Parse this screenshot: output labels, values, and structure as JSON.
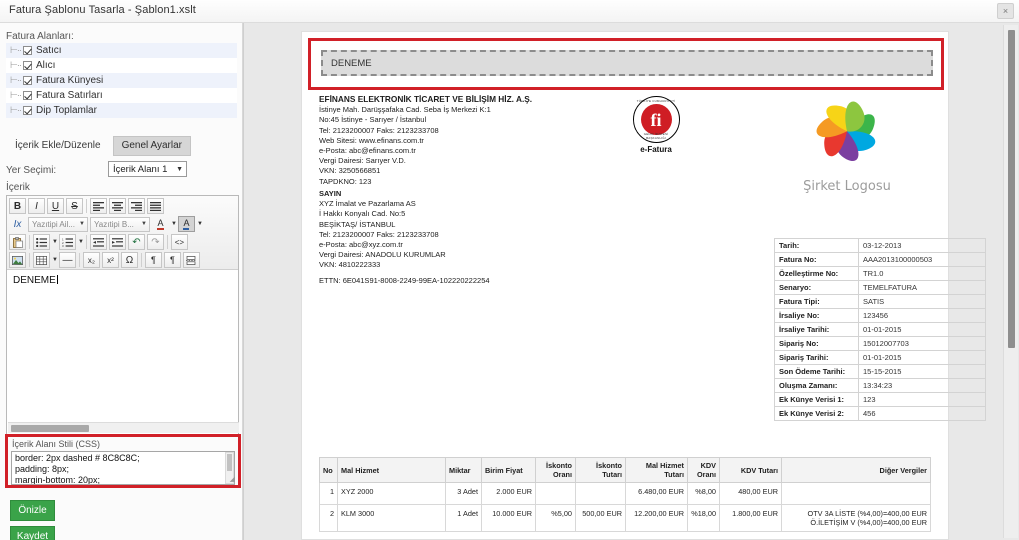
{
  "window": {
    "title": "Fatura Şablonu Tasarla - Şablon1.xslt",
    "close_label": "×"
  },
  "sidebar": {
    "fields_label": "Fatura Alanları:",
    "tree_items": [
      {
        "label": "Satıcı",
        "checked": true
      },
      {
        "label": "Alıcı",
        "checked": true
      },
      {
        "label": "Fatura Künyesi",
        "checked": true
      },
      {
        "label": "Fatura Satırları",
        "checked": true
      },
      {
        "label": "Dip Toplamlar",
        "checked": true
      }
    ],
    "tabs": [
      {
        "label": "İçerik Ekle/Düzenle",
        "active": false
      },
      {
        "label": "Genel Ayarlar",
        "active": true
      }
    ],
    "placement_label": "Yer Seçimi:",
    "placement_value": "İçerik Alanı 1",
    "content_label": "İçerik",
    "editor_text": "DENEME",
    "css_panel_title": "İçerik Alanı Stili (CSS)",
    "css_value": "border: 2px dashed # 8C8C8C;\npadding: 8px;\nmargin-bottom: 20px;",
    "preview_button": "Önizle",
    "save_button": "Kaydet",
    "toolbar": {
      "bold": "B",
      "italic": "I",
      "underline": "U",
      "strike": "S",
      "align_left": "≡",
      "align_center": "≡",
      "align_right": "≡",
      "justify": "≡",
      "clear_format": "Ix",
      "font_family": "Yazıtipi Ail...",
      "font_size": "Yazıtipi B...",
      "text_color": "A",
      "bg_color": "A",
      "paste": "📋",
      "bullet_list": "≔",
      "numbered_list": "≕",
      "outdent": "⇤",
      "indent": "⇥",
      "undo": "↶",
      "redo": "↷",
      "source": "<>",
      "image": "🖼",
      "table": "⊞",
      "hr": "—",
      "subscript": "x₂",
      "superscript": "x²",
      "symbol": "Ω",
      "paragraph": "¶",
      "paragraph_rtl": "¶",
      "page_break": "⎙"
    }
  },
  "document": {
    "header_text": "DENEME",
    "seller": {
      "name": "EFİNANS ELEKTRONİK TİCARET VE BİLİŞİM HİZ. A.Ş.",
      "lines": [
        "İstinye Mah. Darüşşafaka Cad. Seba İş Merkezi K:1",
        "No:45 İstinye - Sarıyer / İstanbul",
        "Tel: 2123200007 Faks: 2123233708",
        "Web Sitesi: www.efinans.com.tr",
        "e-Posta: abc@efinans.com.tr",
        "Vergi Dairesi: Sarıyer V.D.",
        "VKN: 3250566851",
        "TAPDKNO: 123"
      ]
    },
    "buyer": {
      "title": "SAYIN",
      "lines": [
        "XYZ İmalat ve Pazarlama AS",
        "İ Hakkı Konyalı Cad.  No:5",
        "BEŞİKTAŞ/ İSTANBUL",
        "Tel: 2123200007 Faks: 2123233708",
        "e-Posta: abc@xyz.com.tr",
        "Vergi Dairesi: ANADOLU KURUMLAR",
        "VKN: 4810222333"
      ]
    },
    "ettn": "ETTN: 6E041S91-8008-2249-99EA-102220222254",
    "seal": {
      "ring_top": "TÜRKİYE CUMHURİYETİ",
      "ring_bottom": "GELİR İDARESİ BAŞKANLIĞI",
      "mark": "fi",
      "label": "e-Fatura"
    },
    "company_logo_text": "Şirket Logosu",
    "info_rows": [
      {
        "key": "Tarih:",
        "value": "03-12-2013"
      },
      {
        "key": "Fatura No:",
        "value": "AAA2013100000503"
      },
      {
        "key": "Özelleştirme No:",
        "value": "TR1.0"
      },
      {
        "key": "Senaryo:",
        "value": "TEMELFATURA"
      },
      {
        "key": "Fatura Tipi:",
        "value": "SATIS"
      },
      {
        "key": "İrsaliye No:",
        "value": "123456"
      },
      {
        "key": "İrsaliye Tarihi:",
        "value": "01-01-2015"
      },
      {
        "key": "Sipariş No:",
        "value": "15012007703"
      },
      {
        "key": "Sipariş Tarihi:",
        "value": "01-01-2015"
      },
      {
        "key": "Son Ödeme Tarihi:",
        "value": "15-15-2015"
      },
      {
        "key": "Oluşma Zamanı:",
        "value": "13:34:23"
      },
      {
        "key": "Ek Künye Verisi 1:",
        "value": "123"
      },
      {
        "key": "Ek Künye Verisi 2:",
        "value": "456"
      }
    ],
    "items_table": {
      "columns": [
        "No",
        "Mal Hizmet",
        "Miktar",
        "Birim Fiyat",
        "İskonto Oranı",
        "İskonto Tutarı",
        "Mal Hizmet Tutarı",
        "KDV Oranı",
        "KDV Tutarı",
        "Diğer Vergiler"
      ],
      "rows": [
        {
          "no": "1",
          "name": "XYZ 2000",
          "qty": "3 Adet",
          "unit_price": "2.000 EUR",
          "disc_rate": "",
          "disc_amount": "",
          "amount": "6.480,00 EUR",
          "vat_rate": "%8,00",
          "vat_amount": "480,00 EUR",
          "other_taxes": ""
        },
        {
          "no": "2",
          "name": "KLM 3000",
          "qty": "1 Adet",
          "unit_price": "10.000 EUR",
          "disc_rate": "%5,00",
          "disc_amount": "500,00 EUR",
          "amount": "12.200,00 EUR",
          "vat_rate": "%18,00",
          "vat_amount": "1.800,00 EUR",
          "other_taxes": "OTV 3A LİSTE (%4,00)=400,00 EUR\nÖ.İLETİŞİM V (%4,00)=400,00 EUR"
        }
      ]
    }
  },
  "colors": {
    "highlight_red": "#D12028",
    "button_green": "#3AA349",
    "seal_red": "#CF1D24",
    "dashed_border": "#8C8C8C"
  }
}
